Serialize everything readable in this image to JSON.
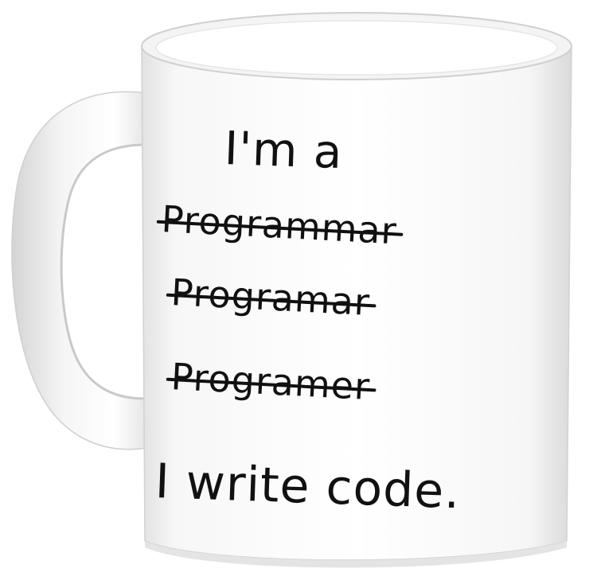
{
  "mug": {
    "body_color": "#ffffff",
    "rim_color": "#f2f2f2",
    "shadow_color": "#d9d9d9",
    "ink_color": "#111111"
  },
  "text": {
    "intro": "I'm a",
    "struck_words": [
      "Programmar",
      "Programar",
      "Programer"
    ],
    "outro": "I write code."
  }
}
